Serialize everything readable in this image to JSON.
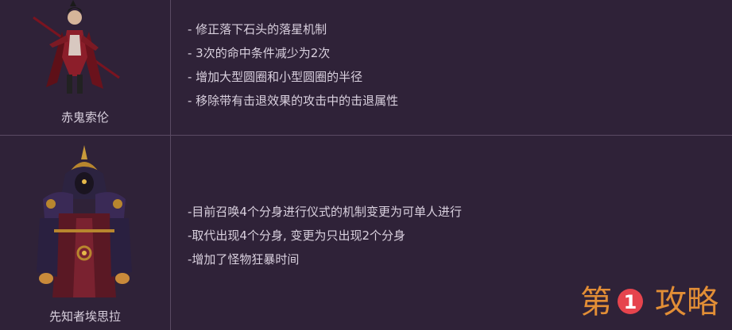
{
  "rows": [
    {
      "character": "赤鬼索伦",
      "notes": [
        "- 修正落下石头的落星机制",
        "- 3次的命中条件减少为2次",
        "- 增加大型圆圈和小型圆圈的半径",
        "- 移除带有击退效果的攻击中的击退属性"
      ]
    },
    {
      "character": "先知者埃思拉",
      "notes": [
        "-目前召唤4个分身进行仪式的机制变更为可单人进行",
        "-取代出现4个分身, 变更为只出现2个分身",
        "-增加了怪物狂暴时间"
      ]
    }
  ],
  "watermark": {
    "left": "第",
    "number": "1",
    "right": "攻略"
  }
}
